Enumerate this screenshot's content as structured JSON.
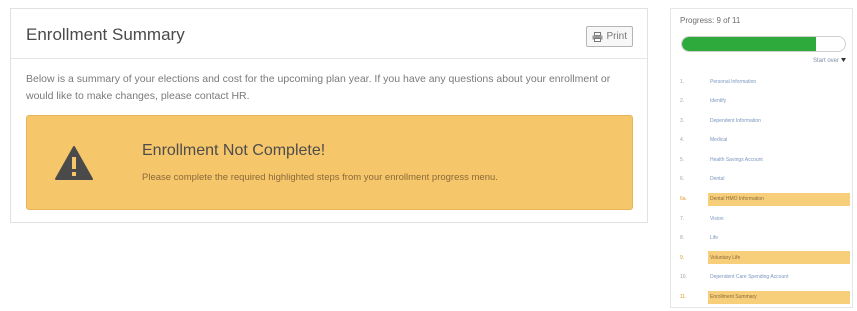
{
  "summary": {
    "title": "Enrollment Summary",
    "print_label": "Print",
    "intro": "Below is a summary of your elections and cost for the upcoming plan year. If you have any questions about your enrollment or would like to make changes, please contact HR.",
    "alert": {
      "title": "Enrollment Not Complete!",
      "message": "Please complete the required highlighted steps from your enrollment progress menu."
    }
  },
  "progress": {
    "title": "Progress: 9 of 11",
    "fraction": 0.82,
    "start_over": "Start over",
    "steps": [
      {
        "num": "1.",
        "label": "Personal Information",
        "highlight": false
      },
      {
        "num": "2.",
        "label": "Identify",
        "highlight": false
      },
      {
        "num": "3.",
        "label": "Dependent Information",
        "highlight": false
      },
      {
        "num": "4.",
        "label": "Medical",
        "highlight": false
      },
      {
        "num": "5.",
        "label": "Health Savings Account",
        "highlight": false
      },
      {
        "num": "6.",
        "label": "Dental",
        "highlight": false
      },
      {
        "num": "6a.",
        "label": "Dental HMO Information",
        "highlight": true
      },
      {
        "num": "7.",
        "label": "Vision",
        "highlight": false
      },
      {
        "num": "8.",
        "label": "Life",
        "highlight": false
      },
      {
        "num": "9.",
        "label": "Voluntary Life",
        "highlight": true
      },
      {
        "num": "10.",
        "label": "Dependent Care Spending Account",
        "highlight": false
      },
      {
        "num": "11.",
        "label": "Enrollment Summary",
        "highlight": true
      }
    ]
  },
  "colors": {
    "alert_bg": "#f6c66b",
    "progress_fill": "#2ea93c",
    "step_highlight": "#f7cf7a"
  }
}
